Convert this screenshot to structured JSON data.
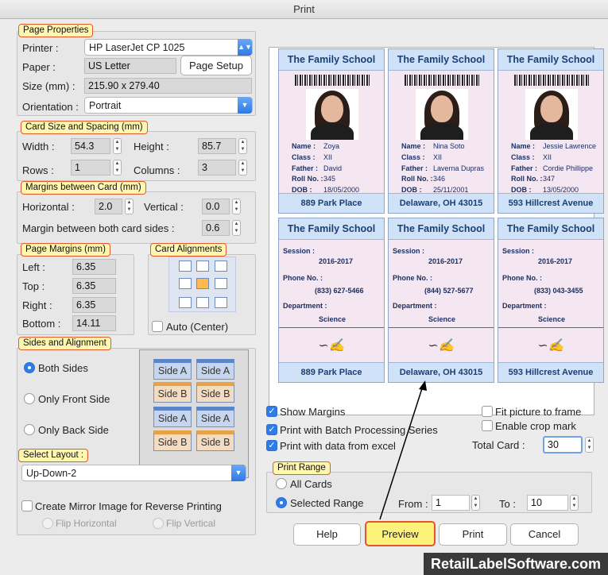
{
  "window_title": "Print",
  "page_properties": {
    "legend": "Page Properties",
    "printer_label": "Printer :",
    "printer_value": "HP LaserJet CP 1025",
    "paper_label": "Paper :",
    "paper_value": "US Letter",
    "page_setup": "Page Setup",
    "size_label": "Size (mm) :",
    "size_value": "215.90 x 279.40",
    "orientation_label": "Orientation :",
    "orientation_value": "Portrait"
  },
  "card_size": {
    "legend": "Card Size and Spacing (mm)",
    "width_label": "Width :",
    "width": "54.3",
    "height_label": "Height :",
    "height": "85.7",
    "rows_label": "Rows :",
    "rows": "1",
    "columns_label": "Columns :",
    "columns": "3"
  },
  "margins_card": {
    "legend": "Margins between Card (mm)",
    "horizontal_label": "Horizontal :",
    "horizontal": "2.0",
    "vertical_label": "Vertical :",
    "vertical": "0.0",
    "both_label": "Margin between both card sides :",
    "both": "0.6"
  },
  "page_margins": {
    "legend": "Page Margins (mm)",
    "left_label": "Left :",
    "left": "6.35",
    "top_label": "Top :",
    "top": "6.35",
    "right_label": "Right :",
    "right": "6.35",
    "bottom_label": "Bottom :",
    "bottom": "14.11"
  },
  "card_alignments": {
    "legend": "Card Alignments",
    "auto_center": "Auto (Center)"
  },
  "sides": {
    "legend": "Sides and Alignment",
    "both": "Both Sides",
    "front": "Only Front Side",
    "back": "Only Back Side",
    "tiles": [
      "Side A",
      "Side A",
      "Side B",
      "Side B",
      "Side A",
      "Side A",
      "Side B",
      "Side B"
    ]
  },
  "select_layout": {
    "legend": "Select Layout :",
    "value": "Up-Down-2"
  },
  "mirror": {
    "label": "Create Mirror Image for Reverse Printing",
    "flip_h": "Flip Horizontal",
    "flip_v": "Flip Vertical"
  },
  "preview_cards_front": [
    {
      "title": "The Family School",
      "name": "Zoya",
      "class": "XII",
      "father": "David",
      "roll": "345",
      "dob": "18/05/2000",
      "address": "889 Park Place"
    },
    {
      "title": "The Family School",
      "name": "Nina Soto",
      "class": "XII",
      "father": "Laverna Dupras",
      "roll": "346",
      "dob": "25/11/2001",
      "address": "Delaware, OH 43015"
    },
    {
      "title": "The Family School",
      "name": "Jessie Lawrence",
      "class": "XII",
      "father": "Cordie Phillippe",
      "roll": "347",
      "dob": "13/05/2000",
      "address": "593 Hillcrest Avenue"
    }
  ],
  "preview_cards_back": [
    {
      "title": "The Family School",
      "session": "2016-2017",
      "phone": "(833) 627-5466",
      "dept": "Science",
      "address": "889 Park Place"
    },
    {
      "title": "The Family School",
      "session": "2016-2017",
      "phone": "(844) 527-5677",
      "dept": "Science",
      "address": "Delaware, OH 43015"
    },
    {
      "title": "The Family School",
      "session": "2016-2017",
      "phone": "(833) 043-3455",
      "dept": "Science",
      "address": "593 Hillcrest Avenue"
    }
  ],
  "card_labels": {
    "name": "Name :",
    "class": "Class :",
    "father": "Father :",
    "roll": "Roll No. :",
    "dob": "DOB :",
    "session": "Session :",
    "phone": "Phone No. :",
    "dept": "Department :"
  },
  "options": {
    "show_margins": "Show Margins",
    "batch": "Print with Batch Processing Series",
    "excel": "Print with data from excel",
    "fit": "Fit picture to frame",
    "crop": "Enable crop mark",
    "total_label": "Total Card :",
    "total": "30"
  },
  "print_range": {
    "legend": "Print Range",
    "all": "All Cards",
    "selected": "Selected Range",
    "from_label": "From :",
    "from": "1",
    "to_label": "To :",
    "to": "10"
  },
  "buttons": {
    "help": "Help",
    "preview": "Preview",
    "print": "Print",
    "cancel": "Cancel"
  },
  "footer_brand": "RetailLabelSoftware.com"
}
